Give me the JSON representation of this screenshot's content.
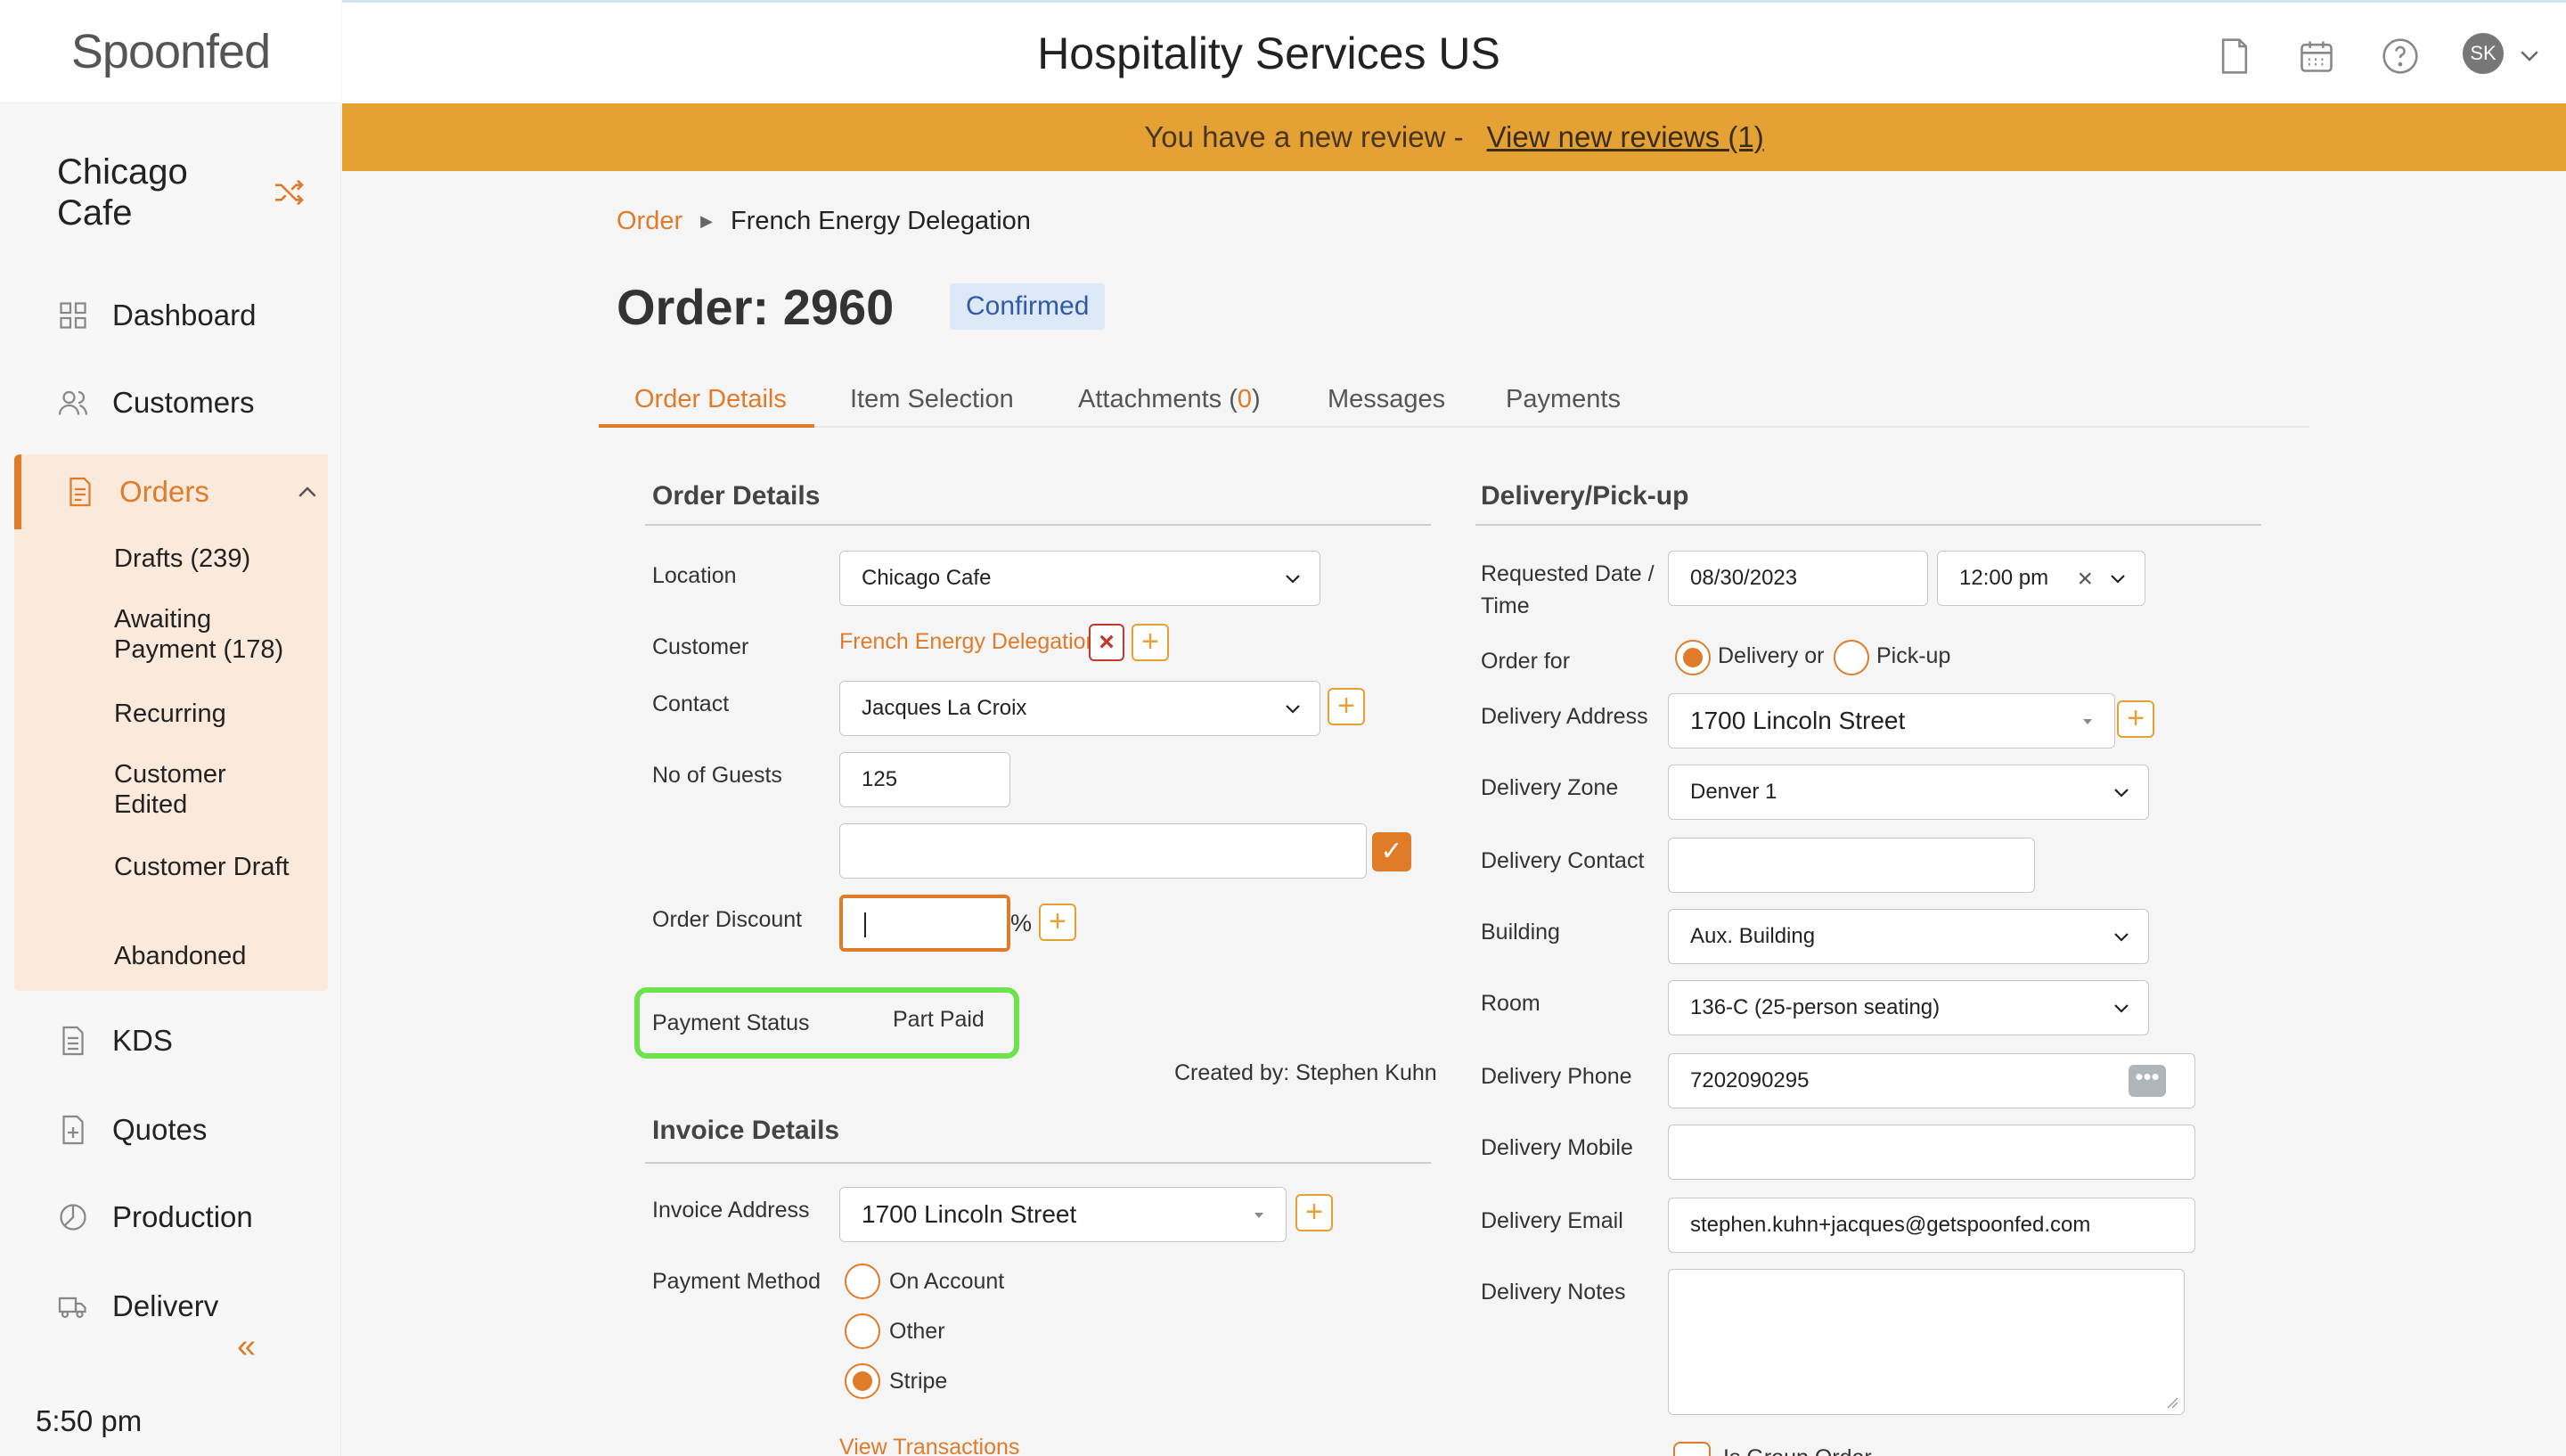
{
  "app": {
    "logo": "Spoonfed",
    "site_title": "Hospitality Services US",
    "avatar_initials": "SK"
  },
  "banner": {
    "text": "You have a new review -",
    "link": "View new reviews (1)"
  },
  "sidebar": {
    "venue": "Chicago Cafe",
    "nav": [
      {
        "label": "Dashboard",
        "icon": "grid-icon"
      },
      {
        "label": "Customers",
        "icon": "users-icon"
      },
      {
        "label": "Orders",
        "icon": "document-icon"
      },
      {
        "label": "KDS",
        "icon": "list-document-icon"
      },
      {
        "label": "Quotes",
        "icon": "add-document-icon"
      },
      {
        "label": "Production",
        "icon": "clock-pie-icon"
      },
      {
        "label": "Deliverv",
        "icon": "truck-icon"
      }
    ],
    "order_sub": [
      "Drafts (239)",
      "Awaiting Payment (178)",
      "Recurring",
      "Customer Edited",
      "Customer Draft",
      "Abandoned"
    ],
    "time": "5:50 pm"
  },
  "breadcrumb": {
    "parent": "Order",
    "current": "French Energy Delegation"
  },
  "order": {
    "title": "Order: 2960",
    "status": "Confirmed"
  },
  "tabs": [
    {
      "label": "Order Details"
    },
    {
      "label": "Item Selection"
    },
    {
      "label": "Attachments (",
      "count": "0",
      "close": ")"
    },
    {
      "label": "Messages"
    },
    {
      "label": "Payments"
    }
  ],
  "order_details": {
    "title": "Order Details",
    "location_label": "Location",
    "location": "Chicago Cafe",
    "customer_label": "Customer",
    "customer": "French Energy Delegation",
    "contact_label": "Contact",
    "contact": "Jacques La Croix",
    "guests_label": "No of Guests",
    "guests": "125",
    "extra_value": "",
    "discount_label": "Order Discount",
    "discount": "",
    "discount_unit": "%",
    "payment_status_label": "Payment Status",
    "payment_status": "Part Paid",
    "created_by": "Created by: Stephen Kuhn"
  },
  "invoice_details": {
    "title": "Invoice Details",
    "address_label": "Invoice Address",
    "address": "1700 Lincoln Street",
    "method_label": "Payment Method",
    "methods": [
      {
        "label": "On Account",
        "selected": false
      },
      {
        "label": "Other",
        "selected": false
      },
      {
        "label": "Stripe",
        "selected": true
      }
    ],
    "transactions_link": "View Transactions"
  },
  "delivery": {
    "title": "Delivery/Pick-up",
    "date_label": "Requested Date / Time",
    "date": "08/30/2023",
    "time": "12:00 pm",
    "order_for_label": "Order for",
    "opt_delivery": "Delivery or",
    "opt_pickup": "Pick-up",
    "order_for": "Delivery",
    "address_label": "Delivery Address",
    "address": "1700 Lincoln Street",
    "zone_label": "Delivery Zone",
    "zone": "Denver 1",
    "contact_label": "Delivery Contact",
    "contact": "",
    "building_label": "Building",
    "building": "Aux. Building",
    "room_label": "Room",
    "room": "136-C (25-person seating)",
    "phone_label": "Delivery Phone",
    "phone": "7202090295",
    "mobile_label": "Delivery Mobile",
    "mobile": "",
    "email_label": "Delivery Email",
    "email": "stephen.kuhn+jacques@getspoonfed.com",
    "notes_label": "Delivery Notes",
    "notes": "",
    "group_order_label": "Is Group Order"
  },
  "colors": {
    "accent": "#e07b2a",
    "banner": "#e4a134",
    "highlight": "#6ee24a",
    "badge": "#dde8f7"
  }
}
